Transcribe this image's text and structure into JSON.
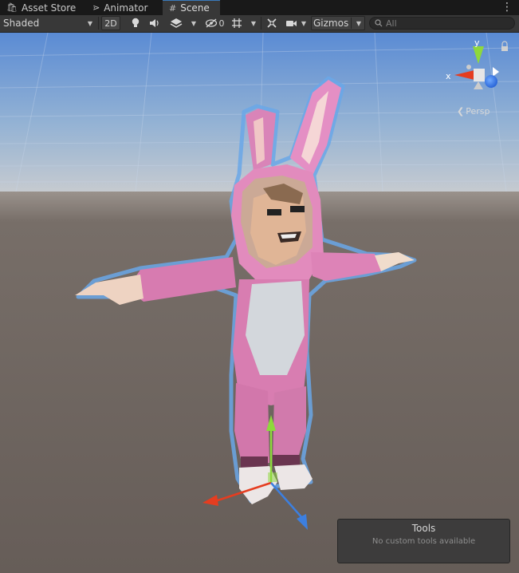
{
  "tabs": [
    {
      "label": "Asset Store",
      "icon": "shopping-bag-icon"
    },
    {
      "label": "Animator",
      "icon": "animator-icon"
    },
    {
      "label": "Scene",
      "icon": "grid-hash-icon"
    }
  ],
  "active_tab": "Scene",
  "toolbar": {
    "draw_mode": "Shaded",
    "mode_2d": "2D",
    "hidden_count": "0",
    "gizmos_label": "Gizmos",
    "search_placeholder": "All"
  },
  "orientation_gizmo": {
    "y_label": "y",
    "x_label": "x",
    "projection": "Persp"
  },
  "tools_overlay": {
    "title": "Tools",
    "message": "No custom tools available"
  },
  "colors": {
    "tab_active_accent": "#3a79bb",
    "toolbar_bg": "#383838",
    "sky_top": "#5f8fd6",
    "horizon": "#c5cdd5",
    "ground": "#6b625d",
    "axis_x": "#e53d20",
    "axis_y": "#8ed83c",
    "axis_z": "#3c7fe0",
    "selection_outline": "#6aa7e8"
  }
}
